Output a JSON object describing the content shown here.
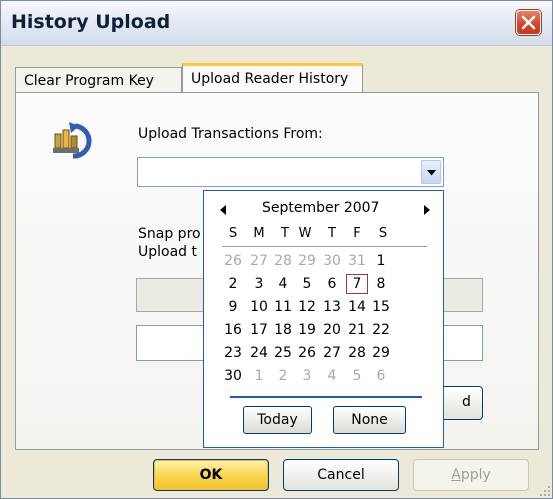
{
  "window": {
    "title": "History Upload"
  },
  "tabs": [
    {
      "label": "Clear Program Key"
    },
    {
      "label": "Upload Reader History"
    }
  ],
  "form": {
    "from_label": "Upload Transactions From:",
    "from_value": "",
    "snap_label_1": "Snap pro",
    "snap_label_2": "Upload t",
    "upload_button_label": "d"
  },
  "calendar": {
    "month_label": "September 2007",
    "weekdays": [
      "S",
      "M",
      "T",
      "W",
      "T",
      "F",
      "S"
    ],
    "weeks": [
      [
        "26",
        "27",
        "28",
        "29",
        "30",
        "31",
        "1"
      ],
      [
        "2",
        "3",
        "4",
        "5",
        "6",
        "7",
        "8"
      ],
      [
        "9",
        "10",
        "11",
        "12",
        "13",
        "14",
        "15"
      ],
      [
        "16",
        "17",
        "18",
        "19",
        "20",
        "21",
        "22"
      ],
      [
        "23",
        "24",
        "25",
        "26",
        "27",
        "28",
        "29"
      ],
      [
        "30",
        "1",
        "2",
        "3",
        "4",
        "5",
        "6"
      ]
    ],
    "selected_day": "7",
    "today_label": "Today",
    "none_label": "None"
  },
  "buttons": {
    "ok": "OK",
    "cancel": "Cancel",
    "apply": "Apply"
  },
  "icons": {
    "close": "close-icon",
    "app": "upload-history-icon",
    "dropdown": "chevron-down-icon",
    "prev_month": "prev-month-icon",
    "next_month": "next-month-icon",
    "grip": "resize-grip-icon"
  },
  "colors": {
    "close_button": "#d6452a",
    "ok_button": "#f8d44b",
    "active_tab_accent": "#ffc83c",
    "calendar_border": "#1d5bbf",
    "selected_day_border": "#a63a32"
  }
}
